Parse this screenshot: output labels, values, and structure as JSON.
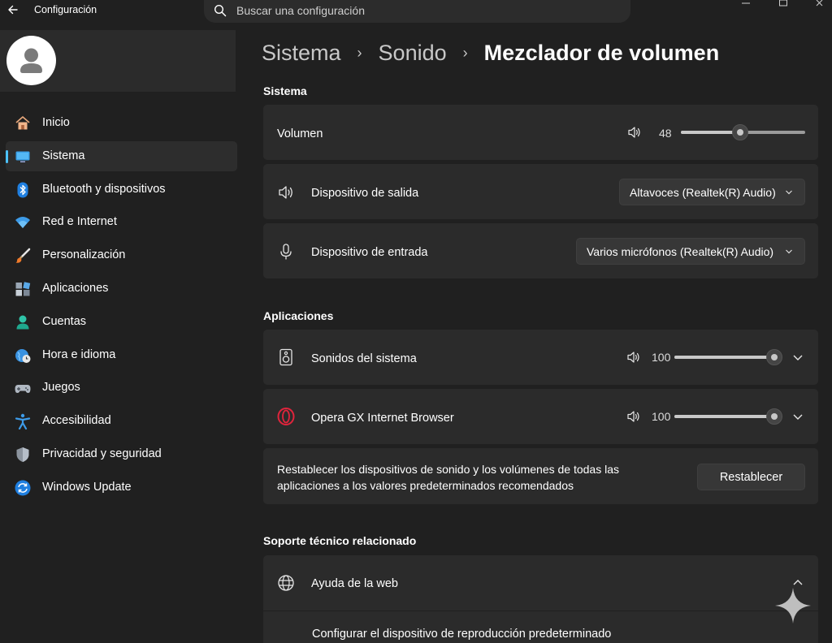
{
  "titlebar": {
    "app_title": "Configuración",
    "search_placeholder": "Buscar una configuración"
  },
  "sidebar": {
    "items": [
      {
        "label": "Inicio",
        "icon": "home-icon"
      },
      {
        "label": "Sistema",
        "icon": "monitor-icon",
        "active": true
      },
      {
        "label": "Bluetooth y dispositivos",
        "icon": "bluetooth-icon"
      },
      {
        "label": "Red e Internet",
        "icon": "wifi-icon"
      },
      {
        "label": "Personalización",
        "icon": "brush-icon"
      },
      {
        "label": "Aplicaciones",
        "icon": "apps-icon"
      },
      {
        "label": "Cuentas",
        "icon": "person-icon"
      },
      {
        "label": "Hora e idioma",
        "icon": "globe-clock-icon"
      },
      {
        "label": "Juegos",
        "icon": "gamepad-icon"
      },
      {
        "label": "Accesibilidad",
        "icon": "accessibility-icon"
      },
      {
        "label": "Privacidad y seguridad",
        "icon": "shield-icon"
      },
      {
        "label": "Windows Update",
        "icon": "update-icon"
      }
    ]
  },
  "breadcrumb": {
    "items": [
      "Sistema",
      "Sonido",
      "Mezclador de volumen"
    ]
  },
  "sections": {
    "system": "Sistema",
    "apps": "Aplicaciones",
    "support": "Soporte técnico relacionado"
  },
  "system": {
    "volume_label": "Volumen",
    "volume_value": "48",
    "output_label": "Dispositivo de salida",
    "output_selected": "Altavoces (Realtek(R) Audio)",
    "input_label": "Dispositivo de entrada",
    "input_selected": "Varios micrófonos (Realtek(R) Audio)"
  },
  "apps": [
    {
      "name": "Sonidos del sistema",
      "volume": "100",
      "icon": "speaker-box-icon"
    },
    {
      "name": "Opera GX Internet Browser",
      "volume": "100",
      "icon": "opera-icon"
    }
  ],
  "reset": {
    "text": "Restablecer los dispositivos de sonido y los volúmenes de todas las aplicaciones a los valores predeterminados recomendados",
    "button": "Restablecer"
  },
  "support": {
    "help_label": "Ayuda de la web",
    "link_text": "Configurar el dispositivo de reproducción predeterminado"
  },
  "colors": {
    "background": "#202020",
    "card": "#2b2b2b",
    "accent": "#4cc2ff"
  }
}
